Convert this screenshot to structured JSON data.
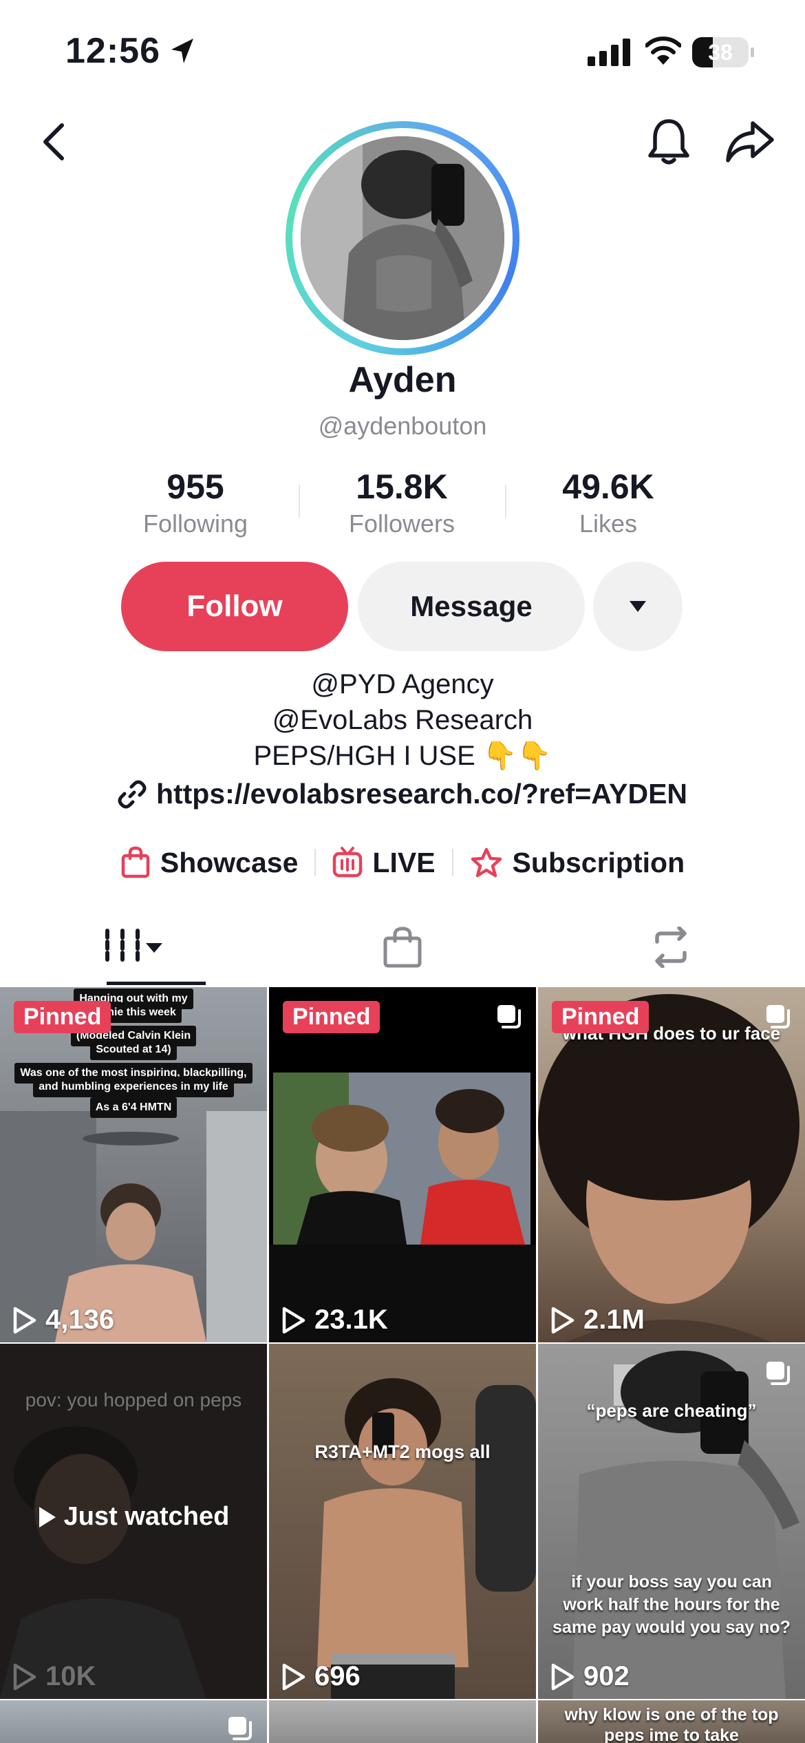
{
  "status_bar": {
    "time": "12:56",
    "battery": "38"
  },
  "profile": {
    "name": "Ayden",
    "handle": "@aydenbouton",
    "stats": [
      {
        "value": "955",
        "label": "Following"
      },
      {
        "value": "15.8K",
        "label": "Followers"
      },
      {
        "value": "49.6K",
        "label": "Likes"
      }
    ]
  },
  "actions": {
    "follow": "Follow",
    "message": "Message"
  },
  "bio": {
    "line1": "@PYD Agency",
    "line2": "@EvoLabs Research",
    "line3": "PEPS/HGH I USE 👇👇",
    "link": "https://evolabsresearch.co/?ref=AYDEN"
  },
  "shortcuts": [
    {
      "label": "Showcase",
      "icon": "shopping-bag-icon"
    },
    {
      "label": "LIVE",
      "icon": "live-tv-icon"
    },
    {
      "label": "Subscription",
      "icon": "subscription-star-icon"
    }
  ],
  "tabs": [
    {
      "icon": "grid-videos-icon"
    },
    {
      "icon": "shop-bag-icon"
    },
    {
      "icon": "repost-icon"
    }
  ],
  "videos": [
    {
      "pinned": "Pinned",
      "views": "4,136",
      "captions": [
        "Hanging out with my",
        "homie this week",
        "(Modeled Calvin Klein",
        "Scouted at 14)",
        "Was one of the most inspiring, blackpilling,",
        "and humbling experiences in my life",
        "As a 6'4 HMTN"
      ]
    },
    {
      "pinned": "Pinned",
      "views": "23.1K"
    },
    {
      "pinned": "Pinned",
      "views": "2.1M",
      "caption": "what HGH does to ur face"
    },
    {
      "views": "10K",
      "caption": "pov: you hopped on peps",
      "overlay": "Just watched"
    },
    {
      "views": "696",
      "caption": "R3TA+MT2 mogs all"
    },
    {
      "views": "902",
      "caption": "“peps are cheating”",
      "caption2": "if your boss say you can work half the hours for the same pay would you say no?"
    },
    {
      "caption": "why klow is one of the top peps ime to take"
    }
  ],
  "colors": {
    "accent": "#e7415a",
    "text": "#161823",
    "muted": "#8a8b91"
  }
}
